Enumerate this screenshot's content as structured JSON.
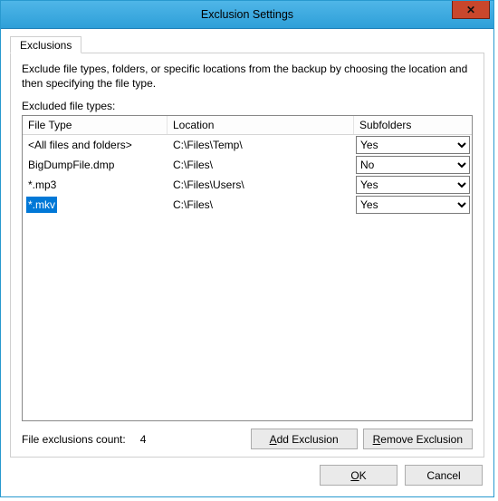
{
  "window": {
    "title": "Exclusion Settings",
    "close_glyph": "✕"
  },
  "tab": {
    "label": "Exclusions"
  },
  "description": "Exclude file types, folders, or specific locations from the backup by choosing the location and then specifying the file type.",
  "list_label": "Excluded file types:",
  "columns": {
    "file_type": "File Type",
    "location": "Location",
    "subfolders": "Subfolders"
  },
  "subfolder_options": [
    "Yes",
    "No"
  ],
  "rows": [
    {
      "file_type": "<All files and folders>",
      "location": "C:\\Files\\Temp\\",
      "subfolders": "Yes",
      "selected": false
    },
    {
      "file_type": "BigDumpFile.dmp",
      "location": "C:\\Files\\",
      "subfolders": "No",
      "selected": false
    },
    {
      "file_type": "*.mp3",
      "location": "C:\\Files\\Users\\",
      "subfolders": "Yes",
      "selected": false
    },
    {
      "file_type": "*.mkv",
      "location": "C:\\Files\\",
      "subfolders": "Yes",
      "selected": true
    }
  ],
  "footer": {
    "count_label": "File exclusions count:",
    "count_value": "4",
    "add_label_pre": "",
    "add_mn": "A",
    "add_label_post": "dd Exclusion",
    "remove_label_pre": "",
    "remove_mn": "R",
    "remove_label_post": "emove Exclusion"
  },
  "dialog": {
    "ok_pre": "",
    "ok_mn": "O",
    "ok_post": "K",
    "cancel": "Cancel"
  }
}
